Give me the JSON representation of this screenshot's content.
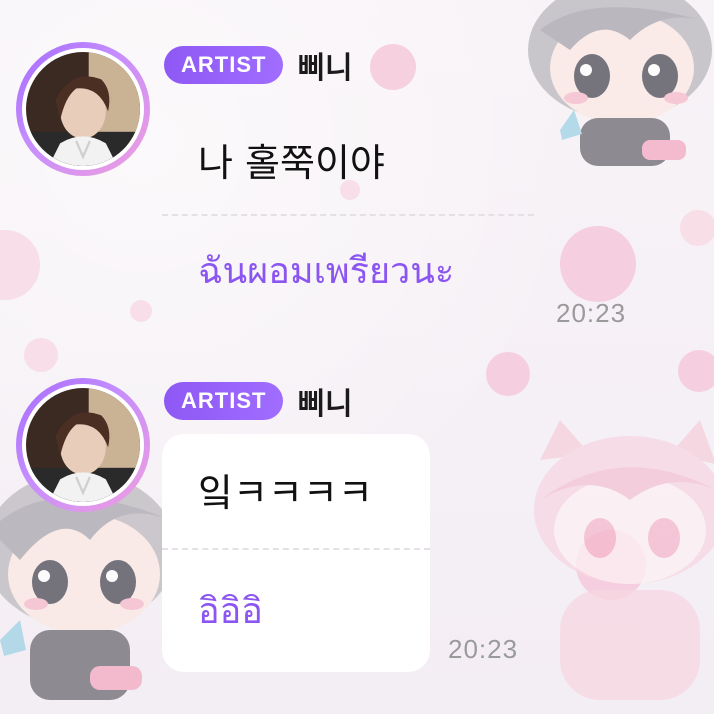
{
  "messages": [
    {
      "badge": "ARTIST",
      "sender": "삐니",
      "text": "나 홀쭉이야",
      "translation": "ฉันผอมเพรียวนะ",
      "time": "20:23"
    },
    {
      "badge": "ARTIST",
      "sender": "삐니",
      "text": "잌ㅋㅋㅋㅋ",
      "translation": "อิอิอิ",
      "time": "20:23"
    }
  ],
  "colors": {
    "accent": "#8b55f2",
    "badge": "#9561f8",
    "timestamp": "#9a9a9a"
  },
  "icons": {
    "avatar": "profile-photo"
  }
}
